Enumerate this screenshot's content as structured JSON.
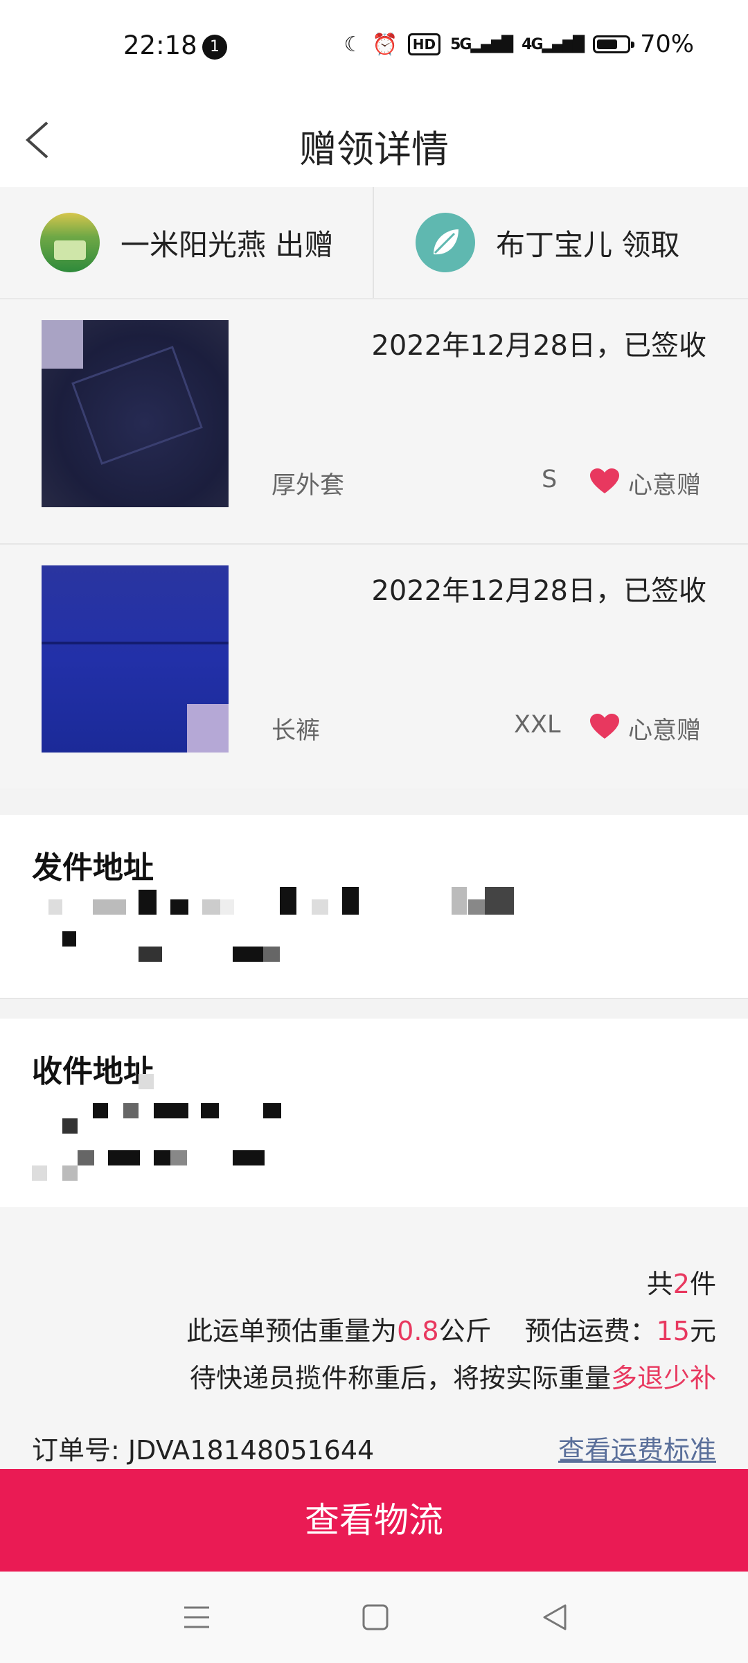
{
  "status_bar": {
    "time": "22:18",
    "notification_count": "1",
    "icons": [
      "moon-icon",
      "alarm-icon",
      "hd-icon",
      "5g-signal-icon",
      "4g-signal-icon",
      "battery-icon"
    ],
    "hd_label": "HD",
    "signal_5g": "5G",
    "signal_4g": "4G",
    "battery_level": 0.7,
    "battery_text": "70%"
  },
  "header": {
    "title": "赠领详情",
    "back_icon": "chevron-left-icon"
  },
  "users": {
    "giver": "一米阳光燕 出赠",
    "receiver": "布丁宝儿 领取"
  },
  "items": [
    {
      "date_status": "2022年12月28日，已签收",
      "name": "厚外套",
      "size": "S",
      "tag": "心意赠"
    },
    {
      "date_status": "2022年12月28日，已签收",
      "name": "长裤",
      "size": "XXL",
      "tag": "心意赠"
    }
  ],
  "send_address": {
    "title": "发件地址"
  },
  "receive_address": {
    "title": "收件地址"
  },
  "summary": {
    "count_prefix": "共",
    "count": "2",
    "count_suffix": "件",
    "weight_prefix": "此运单预估重量为",
    "weight": "0.8",
    "weight_unit": "公斤",
    "fee_prefix": "预估运费：",
    "fee": "15",
    "fee_unit": "元",
    "note_prefix": "待快递员揽件称重后，将按实际重量",
    "note_highlight": "多退少补",
    "order_label": "订单号:",
    "order_no": "JDVA18148051644",
    "fee_link": "查看运费标准"
  },
  "action": {
    "logistics_button": "查看物流"
  },
  "colors": {
    "accent": "#ea1b54",
    "highlight_text": "#e8385f",
    "link": "#5a6f9a",
    "heart": "#e8385f"
  },
  "nav_bar": {
    "icons": [
      "menu-icon",
      "home-square-icon",
      "back-triangle-icon"
    ]
  }
}
